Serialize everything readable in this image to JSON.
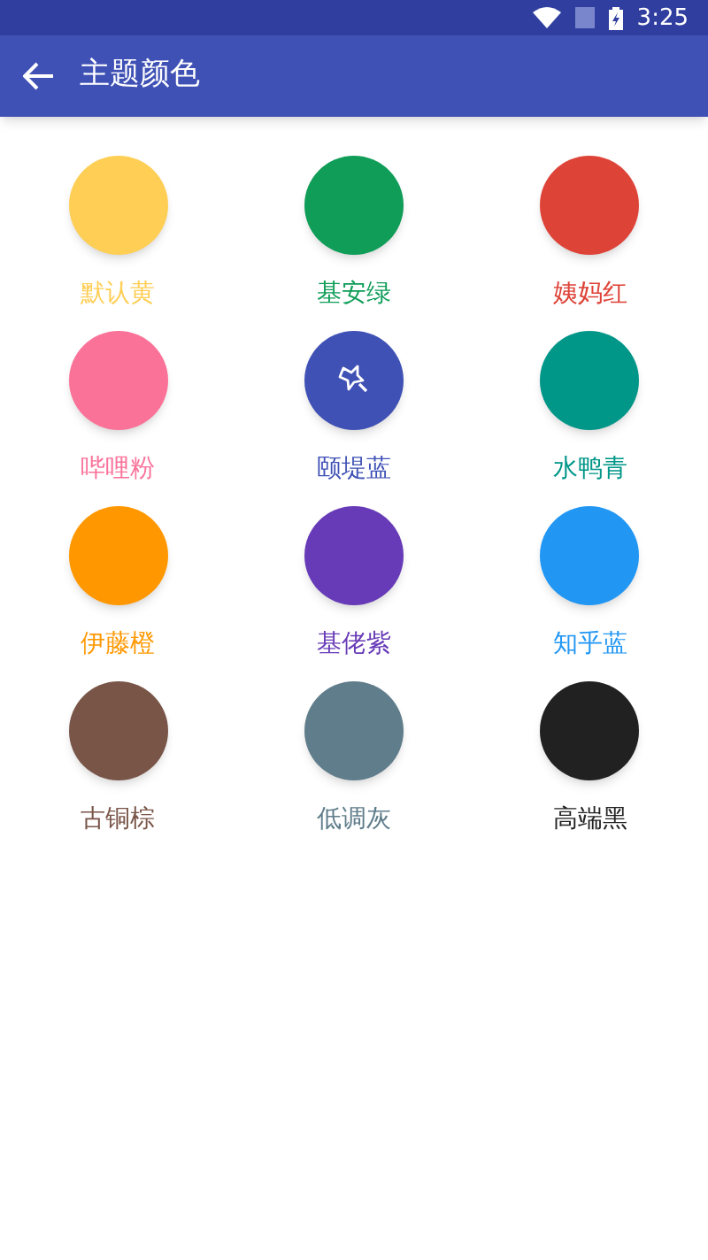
{
  "status_bar": {
    "time": "3:25"
  },
  "toolbar": {
    "title": "主题颜色"
  },
  "themes": [
    {
      "label": "默认黄",
      "color": "#ffce55",
      "selected": false
    },
    {
      "label": "基安绿",
      "color": "#0f9d58",
      "selected": false
    },
    {
      "label": "姨妈红",
      "color": "#de4338",
      "selected": false
    },
    {
      "label": "哔哩粉",
      "color": "#fb7299",
      "selected": false
    },
    {
      "label": "颐堤蓝",
      "color": "#3f51b5",
      "selected": true
    },
    {
      "label": "水鸭青",
      "color": "#009688",
      "selected": false
    },
    {
      "label": "伊藤橙",
      "color": "#ff9800",
      "selected": false
    },
    {
      "label": "基佬紫",
      "color": "#673ab7",
      "selected": false
    },
    {
      "label": "知乎蓝",
      "color": "#2196f3",
      "selected": false
    },
    {
      "label": "古铜棕",
      "color": "#795548",
      "selected": false
    },
    {
      "label": "低调灰",
      "color": "#607d8b",
      "selected": false
    },
    {
      "label": "高端黑",
      "color": "#212121",
      "selected": false
    }
  ]
}
